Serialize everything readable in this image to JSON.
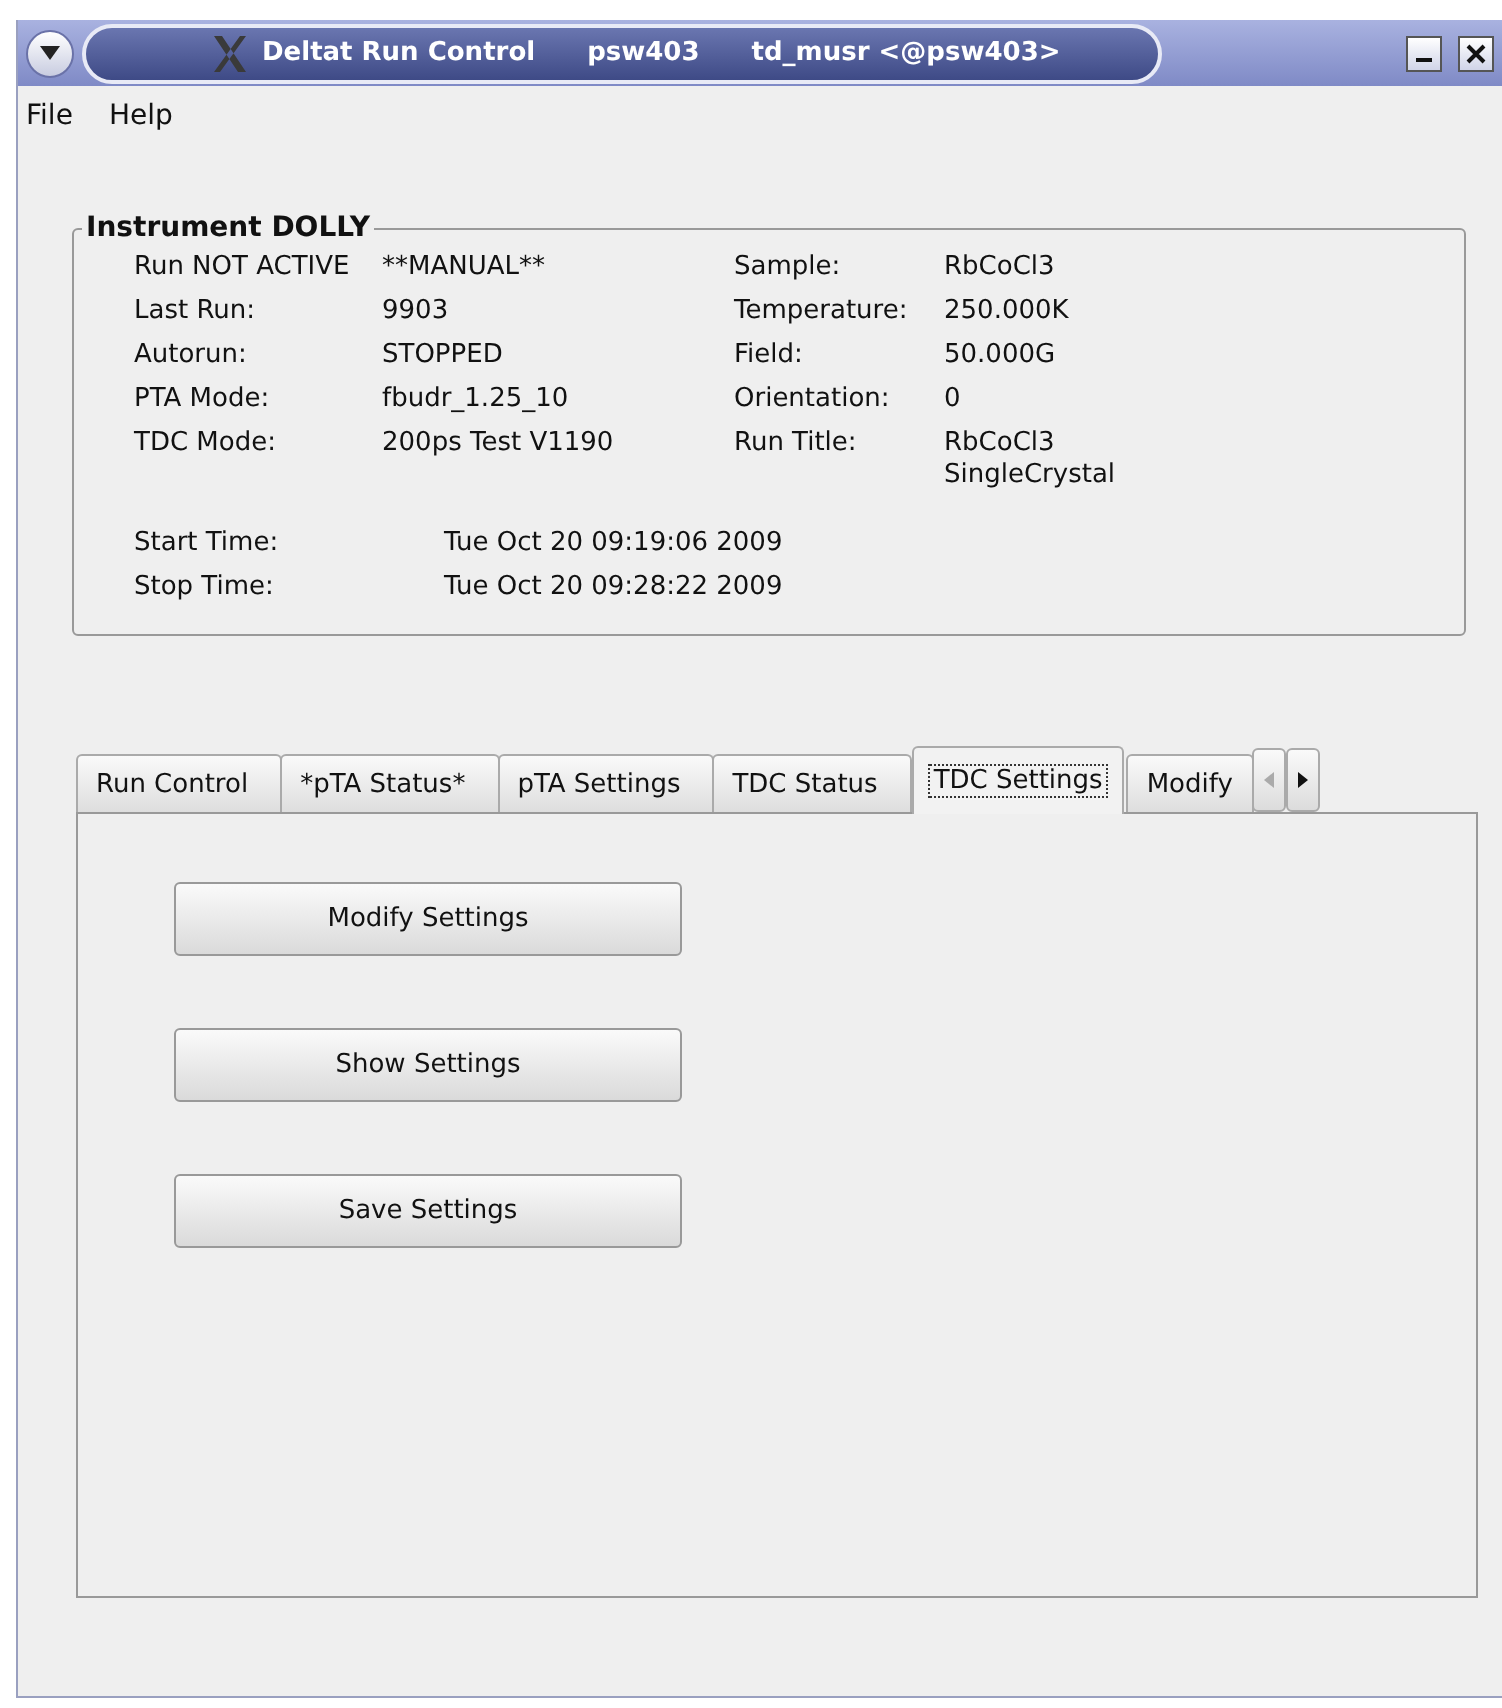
{
  "window": {
    "title": "Deltat Run Control",
    "host": "psw403",
    "user": "td_musr <@psw403>"
  },
  "menu": [
    "File",
    "Help"
  ],
  "instrument": {
    "title": "Instrument DOLLY",
    "left": [
      {
        "label": "Run NOT ACTIVE",
        "value": "**MANUAL**"
      },
      {
        "label": "Last Run:",
        "value": "9903"
      },
      {
        "label": "Autorun:",
        "value": "STOPPED"
      },
      {
        "label": "PTA Mode:",
        "value": "fbudr_1.25_10"
      },
      {
        "label": "TDC Mode:",
        "value": "200ps Test V1190"
      }
    ],
    "right": [
      {
        "label": "Sample:",
        "value": "RbCoCl3"
      },
      {
        "label": "Temperature:",
        "value": "250.000K"
      },
      {
        "label": "Field:",
        "value": "50.000G"
      },
      {
        "label": "Orientation:",
        "value": "0"
      },
      {
        "label": "Run Title:",
        "value": "RbCoCl3 SingleCrystal"
      }
    ],
    "times": [
      {
        "label": "Start Time:",
        "value": "Tue Oct 20 09:19:06 2009"
      },
      {
        "label": "Stop Time:",
        "value": "Tue Oct 20 09:28:22 2009"
      }
    ]
  },
  "tabs": [
    {
      "label": "Run Control",
      "selected": false
    },
    {
      "label": "*pTA Status*",
      "selected": false
    },
    {
      "label": "pTA Settings",
      "selected": false
    },
    {
      "label": "TDC Status",
      "selected": false
    },
    {
      "label": "TDC Settings",
      "selected": true
    },
    {
      "label": "Modify",
      "selected": false
    }
  ],
  "tab_scroll": {
    "left_disabled": true,
    "right_disabled": false
  },
  "buttons": [
    "Modify Settings",
    "Show Settings",
    "Save Settings"
  ]
}
